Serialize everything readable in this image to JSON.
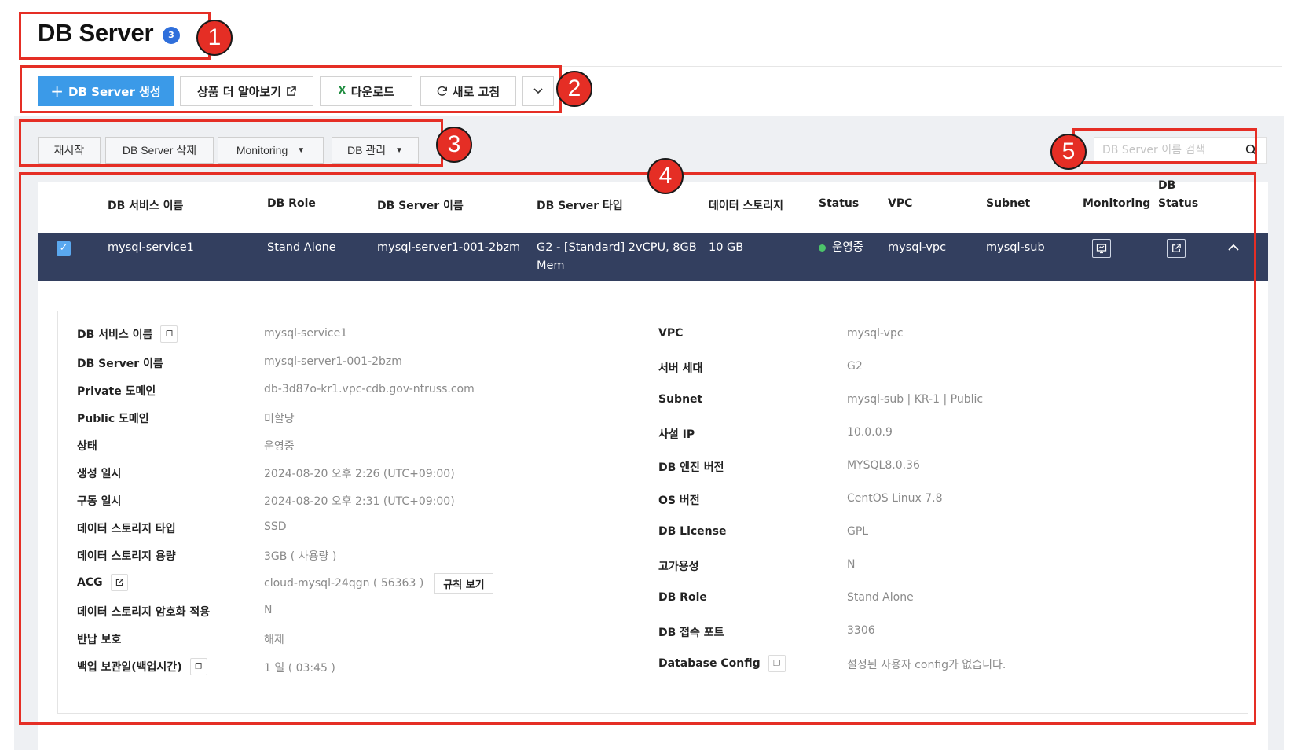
{
  "page": {
    "title": "DB Server",
    "count_badge": "3"
  },
  "toolbar": {
    "create_label": "DB Server 생성",
    "learn_label": "상품 더 알아보기",
    "download_label": "다운로드",
    "refresh_label": "새로 고침"
  },
  "actions": {
    "restart_label": "재시작",
    "delete_label": "DB Server 삭제",
    "monitoring_label": "Monitoring",
    "dbmgmt_label": "DB 관리"
  },
  "search": {
    "placeholder": "DB Server 이름 검색"
  },
  "table": {
    "headers": {
      "service_name": "DB 서비스 이름",
      "role": "DB Role",
      "server_name": "DB Server 이름",
      "server_type": "DB Server 타입",
      "storage": "데이터 스토리지",
      "status": "Status",
      "vpc": "VPC",
      "subnet": "Subnet",
      "monitoring": "Monitoring",
      "db_status_1": "DB",
      "db_status_2": "Status"
    },
    "row": {
      "service_name": "mysql-service1",
      "role": "Stand Alone",
      "server_name": "mysql-server1-001-2bzm",
      "server_type_1": "G2 - [Standard] 2vCPU, 8GB",
      "server_type_2": "Mem",
      "storage": "10 GB",
      "status": "운영중",
      "vpc": "mysql-vpc",
      "subnet": "mysql-sub"
    }
  },
  "detail": {
    "left": [
      {
        "label": "DB 서비스 이름",
        "value": "mysql-service1"
      },
      {
        "label": "DB Server 이름",
        "value": "mysql-server1-001-2bzm"
      },
      {
        "label": "Private 도메인",
        "value": "db-3d87o-kr1.vpc-cdb.gov-ntruss.com"
      },
      {
        "label": "Public 도메인",
        "value": "미할당"
      },
      {
        "label": "상태",
        "value": "운영중"
      },
      {
        "label": "생성 일시",
        "value": "2024-08-20 오후 2:26 (UTC+09:00)"
      },
      {
        "label": "구동 일시",
        "value": "2024-08-20 오후 2:31 (UTC+09:00)"
      },
      {
        "label": "데이터 스토리지 타입",
        "value": "SSD"
      },
      {
        "label": "데이터 스토리지 용량",
        "value": "3GB ( 사용량 )"
      },
      {
        "label": "ACG",
        "value": "cloud-mysql-24qgn ( 56363 )",
        "button": "규칙 보기"
      },
      {
        "label": "데이터 스토리지 암호화 적용",
        "value": "N"
      },
      {
        "label": "반납 보호",
        "value": "해제"
      },
      {
        "label": "백업 보관일(백업시간)",
        "value": "1 일 ( 03:45 )"
      }
    ],
    "right": [
      {
        "label": "VPC",
        "value": "mysql-vpc"
      },
      {
        "label": "서버 세대",
        "value": "G2"
      },
      {
        "label": "Subnet",
        "value": "mysql-sub | KR-1 | Public"
      },
      {
        "label": "사설 IP",
        "value": "10.0.0.9"
      },
      {
        "label": "DB 엔진 버전",
        "value": "MYSQL8.0.36"
      },
      {
        "label": "OS 버전",
        "value": "CentOS Linux 7.8"
      },
      {
        "label": "DB License",
        "value": "GPL"
      },
      {
        "label": "고가용성",
        "value": "N"
      },
      {
        "label": "DB Role",
        "value": "Stand Alone"
      },
      {
        "label": "DB 접속 포트",
        "value": "3306"
      },
      {
        "label": "Database Config",
        "value": "설정된 사용자 config가 없습니다."
      }
    ]
  },
  "annotations": [
    "1",
    "2",
    "3",
    "4",
    "5"
  ],
  "colors": {
    "primary": "#3b9ae8",
    "selected_row": "#333f5f",
    "annotation_red": "#e52e25",
    "status_green": "#4cc36a"
  }
}
